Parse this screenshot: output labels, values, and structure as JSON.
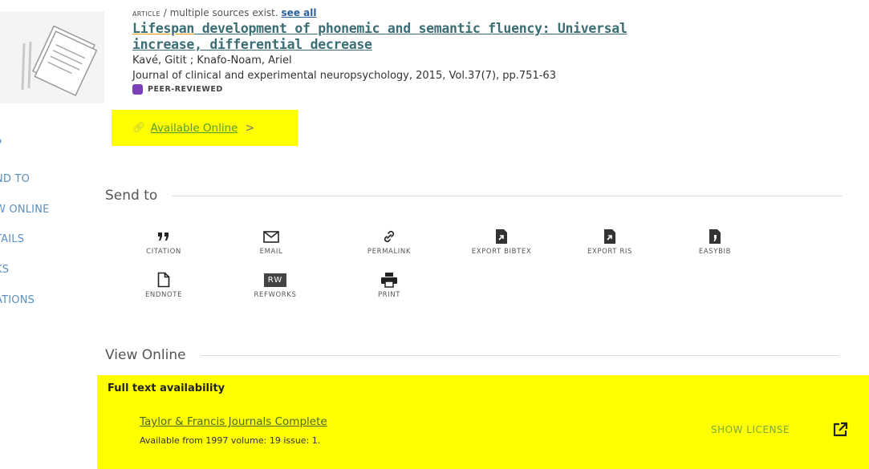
{
  "sidebar": {
    "items": [
      {
        "label": "P"
      },
      {
        "label": "ND TO"
      },
      {
        "label": "W ONLINE"
      },
      {
        "label": "TAILS"
      },
      {
        "label": "KS"
      },
      {
        "label": "ATIONS"
      }
    ]
  },
  "record": {
    "type": "ARTICLE",
    "sources_note": "/ multiple sources exist.",
    "see_all": "see all",
    "title_part1": "Lifespan",
    "title_part2": " development of phonemic and semantic fluency: Universal increase, differential decrease",
    "authors": "Kavé, Gitit ; Knafo-Noam, Ariel",
    "source": "Journal of clinical and experimental neuropsychology, 2015, Vol.37(7), pp.751-63",
    "peer_reviewed": "PEER-REVIEWED",
    "available_online": "Available Online",
    "available_chevron": ">"
  },
  "send_to": {
    "heading": "Send to",
    "actions": [
      {
        "label": "CITATION",
        "icon": "quote-icon"
      },
      {
        "label": "EMAIL",
        "icon": "envelope-icon"
      },
      {
        "label": "PERMALINK",
        "icon": "link-icon"
      },
      {
        "label": "EXPORT BIBTEX",
        "icon": "export-file-icon"
      },
      {
        "label": "EXPORT RIS",
        "icon": "export-file-icon"
      },
      {
        "label": "EASYBIB",
        "icon": "easybib-icon"
      },
      {
        "label": "ENDNOTE",
        "icon": "document-icon"
      },
      {
        "label": "REFWORKS",
        "icon": "refworks-icon",
        "icon_text": "RW"
      },
      {
        "label": "PRINT",
        "icon": "printer-icon"
      }
    ]
  },
  "view_online": {
    "heading": "View Online",
    "full_text_heading": "Full text availability",
    "provider": "Taylor & Francis Journals Complete",
    "coverage": "Available from 1997 volume: 19 issue: 1.",
    "show_license": "SHOW LICENSE"
  },
  "colors": {
    "highlight": "#ffff00",
    "link_green": "#7aaa3a",
    "title_teal": "#3a6e74",
    "nav_blue": "#5a8fbf"
  }
}
